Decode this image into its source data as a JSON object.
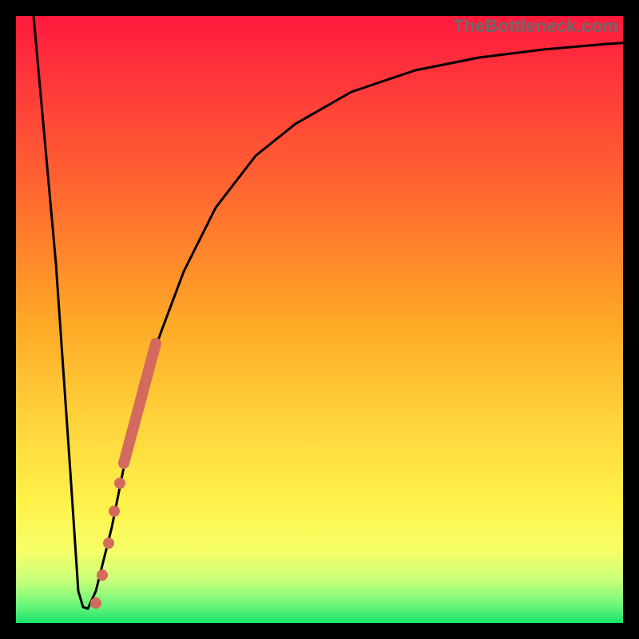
{
  "watermark": "TheBottleneck.com",
  "colors": {
    "marker": "#d46a5e",
    "curve": "#000000",
    "gradient_top": "#ff1a3c",
    "gradient_bottom": "#17e36a"
  },
  "chart_data": {
    "type": "line",
    "title": "",
    "xlabel": "",
    "ylabel": "",
    "xlim": [
      0,
      100
    ],
    "ylim": [
      0,
      100
    ],
    "grid": false,
    "axes_visible": false,
    "note": "Values are approximate coordinates (0-100 each axis) read from the unlabeled plot area. y=0 at bottom (green), y=100 at top (red).",
    "series": [
      {
        "name": "bottleneck-curve",
        "x": [
          3,
          6,
          8,
          10,
          11,
          12,
          14,
          16,
          18,
          20,
          22,
          25,
          30,
          35,
          40,
          50,
          60,
          70,
          80,
          90,
          100
        ],
        "y": [
          100,
          60,
          25,
          3,
          2,
          3,
          10,
          20,
          30,
          38,
          45,
          55,
          67,
          75,
          80,
          87,
          91,
          93,
          94.5,
          95.5,
          96
        ]
      }
    ],
    "markers": {
      "name": "highlighted-segment",
      "type": "points-on-curve",
      "points": [
        {
          "x": 13.5,
          "y": 6
        },
        {
          "x": 14.5,
          "y": 12
        },
        {
          "x": 15.5,
          "y": 18
        },
        {
          "x": 16.5,
          "y": 24
        },
        {
          "x": 21.0,
          "y": 46
        }
      ],
      "thick_segment": {
        "from": {
          "x": 17.0,
          "y": 27
        },
        "to": {
          "x": 22.0,
          "y": 48
        }
      }
    }
  }
}
